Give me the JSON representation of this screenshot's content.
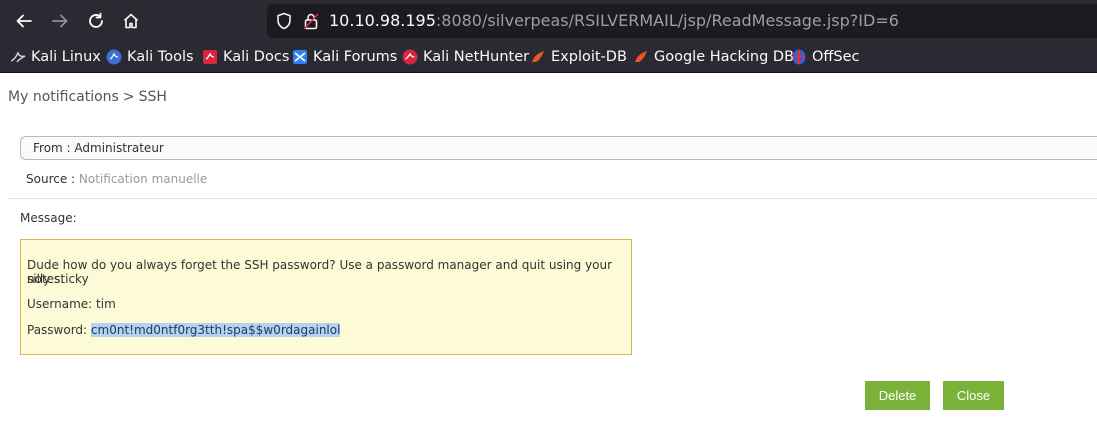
{
  "browser": {
    "url_host": "10.10.98.195",
    "url_rest": ":8080/silverpeas/RSILVERMAIL/jsp/ReadMessage.jsp?ID=6",
    "bookmarks": [
      {
        "label": "Kali Linux",
        "icon": "kali-dragon-icon"
      },
      {
        "label": "Kali Tools",
        "icon": "kali-tools-icon"
      },
      {
        "label": "Kali Docs",
        "icon": "kali-docs-icon"
      },
      {
        "label": "Kali Forums",
        "icon": "kali-forums-icon"
      },
      {
        "label": "Kali NetHunter",
        "icon": "kali-nethunter-icon"
      },
      {
        "label": "Exploit-DB",
        "icon": "exploit-db-icon"
      },
      {
        "label": "Google Hacking DB",
        "icon": "ghdb-icon"
      },
      {
        "label": "OffSec",
        "icon": "offsec-icon"
      }
    ]
  },
  "breadcrumb": {
    "root": "My notifications",
    "separator": ">",
    "current": "SSH"
  },
  "message": {
    "from": "From : Administrateur",
    "source_label": "Source :",
    "source_value": "Notification manuelle",
    "message_label": "Message:",
    "body_line1": "Dude how do you always forget the SSH password? Use a password manager and quit using your silly sticky",
    "body_line2": "notes.",
    "username_line": "Username: tim",
    "password_label": "Password:",
    "password_value": "cm0nt!md0ntf0rg3tth!spa$$w0rdagainlol"
  },
  "actions": {
    "delete": "Delete",
    "close": "Close"
  },
  "colors": {
    "chrome": "#2b2a33",
    "urlbar": "#1c1b22",
    "button_green": "#7bb23a",
    "message_bg": "#fdfbd7",
    "message_border": "#d6b94a",
    "selection": "#b7d2ee"
  }
}
